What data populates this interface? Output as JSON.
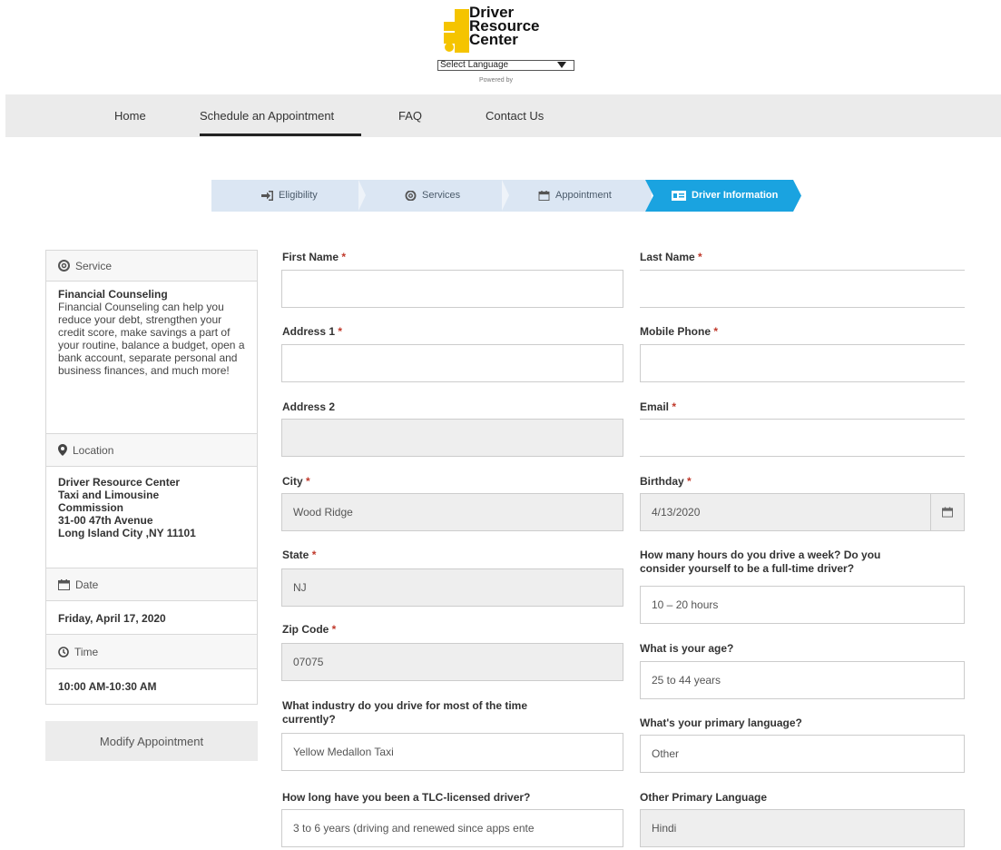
{
  "header": {
    "logo_lines": [
      "Driver",
      "Resource",
      "Center"
    ],
    "language_select": "Select Language",
    "powered_by": "Powered by"
  },
  "nav": {
    "items": [
      "Home",
      "Schedule an Appointment",
      "FAQ",
      "Contact Us"
    ],
    "active_index": 1
  },
  "steps": {
    "items": [
      "Eligibility",
      "Services",
      "Appointment",
      "Driver Information"
    ],
    "active_index": 3,
    "active_color": "#1aa3e0"
  },
  "sidebar": {
    "service_heading": "Service",
    "service_name": "Financial Counseling",
    "service_desc": "Financial Counseling can help you reduce your debt, strengthen your credit score, make savings a part of your routine, balance a budget, open a bank account, separate personal and business finances, and much more!",
    "location_heading": "Location",
    "location_lines": [
      "Driver Resource Center",
      "Taxi and Limousine",
      "Commission",
      "31-00 47th Avenue",
      "Long Island City ,NY 11101"
    ],
    "date_heading": "Date",
    "date_value": "Friday, April 17, 2020",
    "time_heading": "Time",
    "time_value": "10:00 AM-10:30 AM",
    "modify_button": "Modify Appointment"
  },
  "form": {
    "first_name": {
      "label": "First Name",
      "value": ""
    },
    "last_name": {
      "label": "Last Name",
      "value": ""
    },
    "address1": {
      "label": "Address 1",
      "value": ""
    },
    "mobile_phone": {
      "label": "Mobile Phone",
      "value": ""
    },
    "address2": {
      "label": "Address 2",
      "value": ""
    },
    "email": {
      "label": "Email",
      "value": ""
    },
    "city": {
      "label": "City",
      "value": "Wood Ridge"
    },
    "birthday": {
      "label": "Birthday",
      "value": "4/13/2020"
    },
    "state": {
      "label": "State",
      "value": "NJ"
    },
    "hours": {
      "label_line1": "How many hours do you drive a week? Do you",
      "label_line2": "consider yourself to be a full-time driver?",
      "value": "10 – 20 hours"
    },
    "zip": {
      "label": "Zip Code",
      "value": "07075"
    },
    "age": {
      "label": "What is your age?",
      "value": "25 to 44 years"
    },
    "industry": {
      "label_line1": "What industry do you drive for most of the time",
      "label_line2": "currently?",
      "value": "Yellow Medallon Taxi"
    },
    "primary_language": {
      "label": "What's your primary language?",
      "value": "Other"
    },
    "tlc_years": {
      "label": "How long have you been a TLC-licensed driver?",
      "value": "3 to 6 years (driving and renewed since apps ente"
    },
    "other_language": {
      "label": "Other Primary Language",
      "value": "Hindi"
    },
    "required_mark": "*"
  }
}
